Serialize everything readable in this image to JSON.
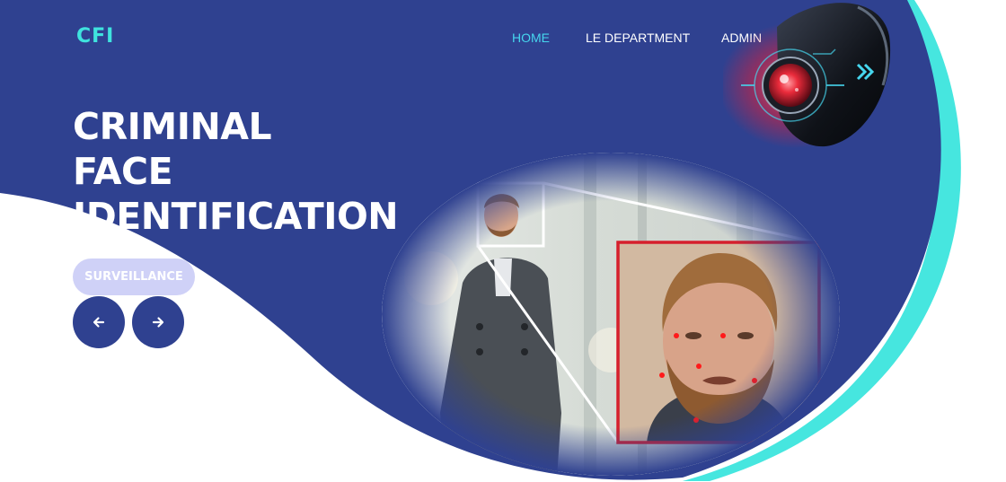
{
  "brand": {
    "logo": "CFI"
  },
  "nav": {
    "items": [
      {
        "label": "HOME",
        "active": true
      },
      {
        "label": "LE DEPARTMENT",
        "active": false
      },
      {
        "label": "ADMIN",
        "active": false
      }
    ]
  },
  "hero": {
    "title_lines": [
      "CRIMINAL",
      "FACE",
      "IDENTIFICATION"
    ],
    "pill_label": "SURVEILLANCE",
    "prev_icon": "arrow-left-icon",
    "next_icon": "arrow-right-icon"
  },
  "colors": {
    "hero_blue": "#2f4190",
    "accent_cyan": "#46e6df",
    "nav_active": "#46d6ee",
    "pill_bg": "#cfd1f7",
    "detection_red": "#d61f2c"
  }
}
